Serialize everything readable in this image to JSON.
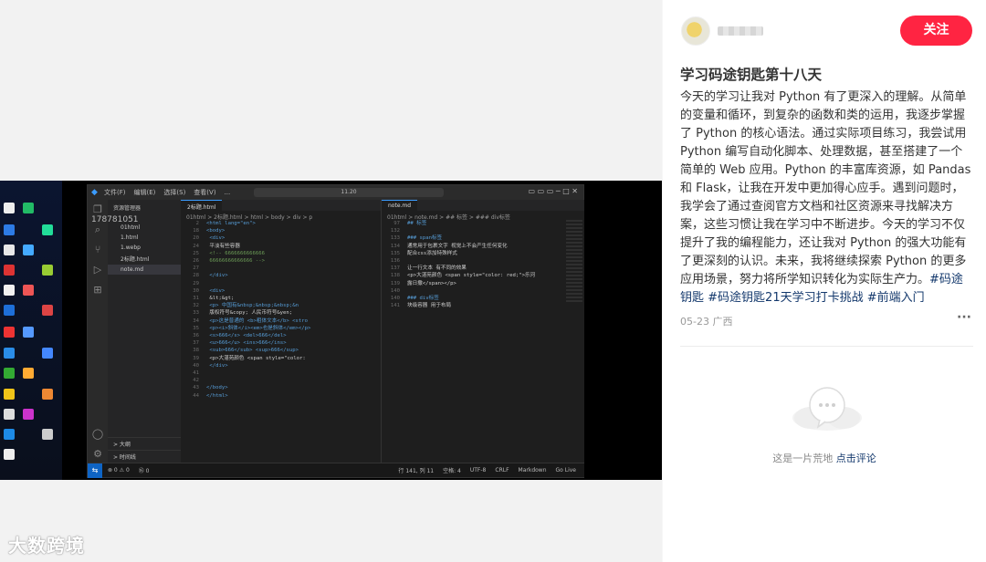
{
  "author": {
    "follow_label": "关注"
  },
  "post": {
    "title": "学习码途钥匙第十八天",
    "body": "今天的学习让我对 Python 有了更深入的理解。从简单的变量和循环，到复杂的函数和类的运用，我逐步掌握了 Python 的核心语法。通过实际项目练习，我尝试用 Python 编写自动化脚本、处理数据，甚至搭建了一个简单的 Web 应用。Python 的丰富库资源，如 Pandas 和 Flask，让我在开发中更加得心应手。遇到问题时，我学会了通过查阅官方文档和社区资源来寻找解决方案，这些习惯让我在学习中不断进步。今天的学习不仅提升了我的编程能力，还让我对 Python 的强大功能有了更深刻的认识。未来，我将继续探索 Python 的更多应用场景，努力将所学知识转化为实际生产力。",
    "tags": [
      "#码途钥匙",
      "#码途钥匙21天学习打卡挑战",
      "#前端入门"
    ],
    "date": "05-23",
    "location": "广西",
    "more_label": "···"
  },
  "comments": {
    "empty_text": "这是一片荒地",
    "cta": "点击评论"
  },
  "watermark": "大数跨境",
  "screenshot": {
    "menu": [
      "文件(F)",
      "编辑(E)",
      "选择(S)",
      "查看(V)",
      "..."
    ],
    "search": "11.20",
    "explorer_header": "资源管理器",
    "phone_text": "178781051",
    "files": [
      "01html",
      "1.html",
      "1.webp",
      "2标题.html",
      "note.md"
    ],
    "explorer_bottom": [
      "> 大纲",
      "> 时间线"
    ],
    "tab_left": "2标题.html",
    "tab_right": "note.md",
    "crumb_left": "01html > 2标题.html > html > body > div > p",
    "crumb_right": "01html > note.md > ## 标签 > ### div标签",
    "code_left": [
      [
        "2",
        "<html lang=\"en\">"
      ],
      [
        "18",
        "<body>"
      ],
      [
        "20",
        "    <div>"
      ],
      [
        "24",
        "        平淡有些容器"
      ],
      [
        "25",
        "            <!-- 6666666666666"
      ],
      [
        "26",
        "        66666666666666 -->"
      ],
      [
        "27",
        ""
      ],
      [
        "28",
        "    </div>"
      ],
      [
        "29",
        ""
      ],
      [
        "30",
        "    <div>"
      ],
      [
        "31",
        "        &lt;&gt;"
      ],
      [
        "32",
        "        <p> 中国有&nbsp;&nbsp;&nbsp;&n"
      ],
      [
        "33",
        "        版权符号&copy;    人民币符号&yen;"
      ],
      [
        "34",
        "        <p>这是普通的 <b>粗体文本</b> <stro"
      ],
      [
        "35",
        "        <p><i>斜体</i><em>也是斜体</em></p>"
      ],
      [
        "36",
        "        <s>666</s> <del>666</del>"
      ],
      [
        "37",
        "        <u>666</u>  <ins>666</ins>"
      ],
      [
        "38",
        "        <sub>666</sub> <sup>666</sup>"
      ],
      [
        "39",
        "        <p>大湛苑颜色 <span style=\"color:"
      ],
      [
        "40",
        "    </div>"
      ],
      [
        "41",
        ""
      ],
      [
        "42",
        ""
      ],
      [
        "43",
        "</body>"
      ],
      [
        "44",
        "</html>"
      ]
    ],
    "code_right": [
      [
        "97",
        "## 标签"
      ],
      [
        "132",
        ""
      ],
      [
        "133",
        "### span标签"
      ],
      [
        "134",
        "通常用于包裹文字 视觉上不会产生任何变化"
      ],
      [
        "135",
        "配合css添加特殊样式"
      ],
      [
        "136",
        ""
      ],
      [
        "137",
        "让一行文本 有不同的效果"
      ],
      [
        "138",
        "<p>大湛苑颜色 <span style=\"color: red;\">乐河"
      ],
      [
        "139",
        "露日撒</span></p>"
      ],
      [
        "140",
        ""
      ],
      [
        "140",
        "### div标签"
      ],
      [
        "141",
        "块级容器 用于布局"
      ]
    ],
    "status_left": [
      "⊗ 0 ⚠ 0",
      "⑯ 0"
    ],
    "status_right": [
      "行 141, 列 11",
      "空格: 4",
      "UTF-8",
      "CRLF",
      "Markdown",
      "Go Live"
    ]
  }
}
